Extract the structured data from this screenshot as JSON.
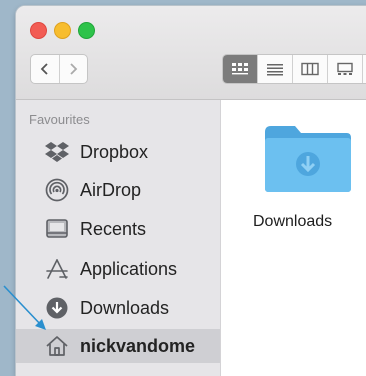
{
  "sidebar": {
    "section_title": "Favourites",
    "items": [
      {
        "label": "Dropbox",
        "icon": "dropbox-icon"
      },
      {
        "label": "AirDrop",
        "icon": "airdrop-icon"
      },
      {
        "label": "Recents",
        "icon": "recents-icon"
      },
      {
        "label": "Applications",
        "icon": "applications-icon"
      },
      {
        "label": "Downloads",
        "icon": "downloads-icon"
      },
      {
        "label": "nickvandome",
        "icon": "home-icon",
        "selected": true
      }
    ]
  },
  "content": {
    "items": [
      {
        "label": "Downloads",
        "icon": "downloads-folder-icon",
        "color": "#5bb4e8"
      }
    ]
  },
  "toolbar": {
    "view_modes": [
      "icon-view-icon",
      "list-view-icon",
      "column-view-icon",
      "gallery-view-icon"
    ],
    "active_view": "icon"
  },
  "colors": {
    "selection": "#cfcfd3",
    "folder": "#5bb4e8",
    "pointer": "#2a8fce"
  }
}
